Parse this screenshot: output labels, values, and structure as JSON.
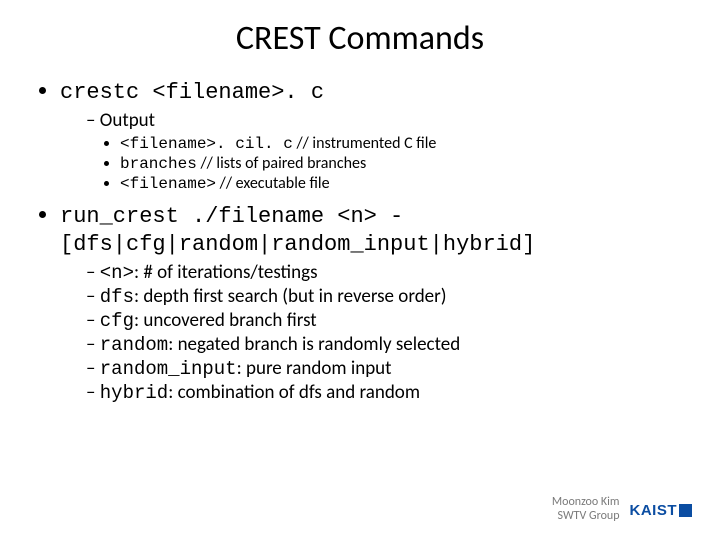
{
  "title": "CREST Commands",
  "bullets": [
    {
      "command": "crestc <filename>. c",
      "sub": [
        {
          "label": "Output",
          "items": [
            {
              "code": "<filename>. cil. c",
              "desc": "   // instrumented C file"
            },
            {
              "code": "branches",
              "desc": " // lists of paired branches"
            },
            {
              "code": "<filename>",
              "desc": "  // executable file"
            }
          ]
        }
      ]
    },
    {
      "command": "run_crest ./filename <n> -[dfs|cfg|random|random_input|hybrid]",
      "options": [
        {
          "code": "<n>",
          "desc": ": # of iterations/testings"
        },
        {
          "code": "dfs",
          "desc": ": depth first search (but in reverse order)"
        },
        {
          "code": "cfg",
          "desc": ": uncovered branch first"
        },
        {
          "code": "random",
          "desc": ": negated branch is randomly selected"
        },
        {
          "code": "random_input",
          "desc": ": pure random input"
        },
        {
          "code": "hybrid",
          "desc": ": combination of dfs and random"
        }
      ]
    }
  ],
  "footer": {
    "line1": "Moonzoo Kim",
    "line2": "SWTV Group",
    "logo": "KAIST"
  }
}
